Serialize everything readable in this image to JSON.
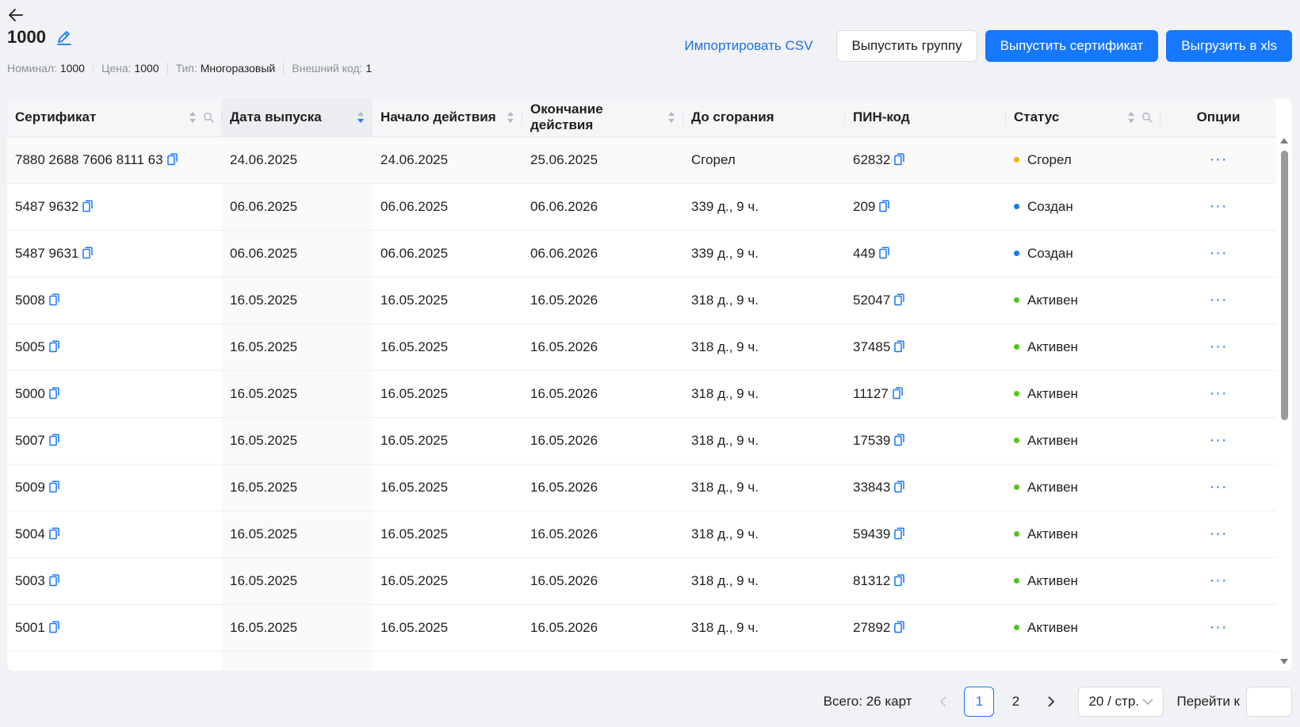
{
  "header": {
    "title": "1000",
    "meta": [
      {
        "label": "Номинал:",
        "value": "1000"
      },
      {
        "label": "Цена:",
        "value": "1000"
      },
      {
        "label": "Тип:",
        "value": "Многоразовый"
      },
      {
        "label": "Внешний код:",
        "value": "1"
      }
    ]
  },
  "actions": {
    "import_csv": "Импортировать CSV",
    "issue_group": "Выпустить группу",
    "issue_certificate": "Выпустить сертификат",
    "export_xls": "Выгрузить в xls"
  },
  "table": {
    "columns": {
      "certificate": "Сертификат",
      "issue_date": "Дата выпуска",
      "start": "Начало действия",
      "end": "Окончание действия",
      "until_burn": "До сгорания",
      "pin": "ПИН-код",
      "status": "Статус",
      "options": "Опции"
    },
    "more_label": "···",
    "rows": [
      {
        "cert": "7880 2688 7606 8111 63",
        "issued": "24.06.2025",
        "start": "24.06.2025",
        "end": "25.06.2025",
        "left": "Сгорел",
        "pin": "62832",
        "status": "Сгорел",
        "status_color": "#faad14"
      },
      {
        "cert": "5487 9632",
        "issued": "06.06.2025",
        "start": "06.06.2025",
        "end": "06.06.2026",
        "left": "339 д., 9 ч.",
        "pin": "209",
        "status": "Создан",
        "status_color": "#1677ff"
      },
      {
        "cert": "5487 9631",
        "issued": "06.06.2025",
        "start": "06.06.2025",
        "end": "06.06.2026",
        "left": "339 д., 9 ч.",
        "pin": "449",
        "status": "Создан",
        "status_color": "#1677ff"
      },
      {
        "cert": "5008",
        "issued": "16.05.2025",
        "start": "16.05.2025",
        "end": "16.05.2026",
        "left": "318 д., 9 ч.",
        "pin": "52047",
        "status": "Активен",
        "status_color": "#52c41a"
      },
      {
        "cert": "5005",
        "issued": "16.05.2025",
        "start": "16.05.2025",
        "end": "16.05.2026",
        "left": "318 д., 9 ч.",
        "pin": "37485",
        "status": "Активен",
        "status_color": "#52c41a"
      },
      {
        "cert": "5000",
        "issued": "16.05.2025",
        "start": "16.05.2025",
        "end": "16.05.2026",
        "left": "318 д., 9 ч.",
        "pin": "11127",
        "status": "Активен",
        "status_color": "#52c41a"
      },
      {
        "cert": "5007",
        "issued": "16.05.2025",
        "start": "16.05.2025",
        "end": "16.05.2026",
        "left": "318 д., 9 ч.",
        "pin": "17539",
        "status": "Активен",
        "status_color": "#52c41a"
      },
      {
        "cert": "5009",
        "issued": "16.05.2025",
        "start": "16.05.2025",
        "end": "16.05.2026",
        "left": "318 д., 9 ч.",
        "pin": "33843",
        "status": "Активен",
        "status_color": "#52c41a"
      },
      {
        "cert": "5004",
        "issued": "16.05.2025",
        "start": "16.05.2025",
        "end": "16.05.2026",
        "left": "318 д., 9 ч.",
        "pin": "59439",
        "status": "Активен",
        "status_color": "#52c41a"
      },
      {
        "cert": "5003",
        "issued": "16.05.2025",
        "start": "16.05.2025",
        "end": "16.05.2026",
        "left": "318 д., 9 ч.",
        "pin": "81312",
        "status": "Активен",
        "status_color": "#52c41a"
      },
      {
        "cert": "5001",
        "issued": "16.05.2025",
        "start": "16.05.2025",
        "end": "16.05.2026",
        "left": "318 д., 9 ч.",
        "pin": "27892",
        "status": "Активен",
        "status_color": "#52c41a"
      },
      {
        "cert": "",
        "issued": "",
        "start": "",
        "end": "",
        "left": "",
        "pin": "",
        "status": "",
        "status_color": ""
      }
    ]
  },
  "pagination": {
    "total": "Всего: 26 карт",
    "pages": [
      "1",
      "2"
    ],
    "current": "1",
    "page_size": "20 / стр.",
    "goto_label": "Перейти к",
    "goto_value": ""
  },
  "colors": {
    "accent": "#1677ff",
    "burned": "#faad14",
    "created": "#1677ff",
    "active": "#52c41a"
  }
}
